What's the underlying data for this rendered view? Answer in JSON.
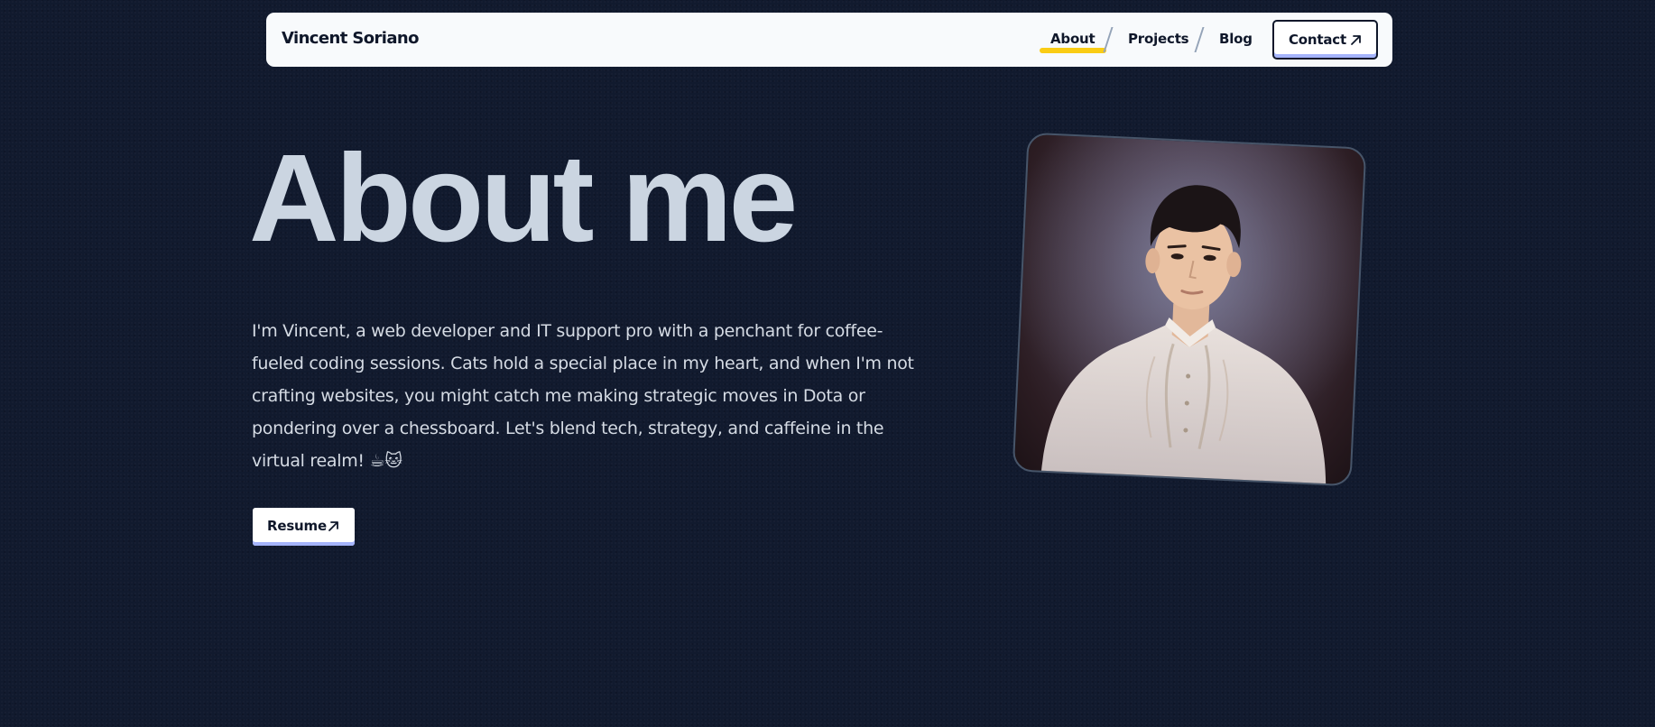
{
  "nav": {
    "brand": "Vincent Soriano",
    "links": [
      {
        "label": "About",
        "active": true
      },
      {
        "label": "Projects"
      },
      {
        "label": "Blog"
      }
    ],
    "contact_label": "Contact",
    "contact_icon": "arrow-up-right-icon"
  },
  "hero": {
    "headline": "About me",
    "bio": "I'm Vincent, a web developer and IT support pro with a penchant for coffee-fueled coding sessions. Cats hold a special place in my heart, and when I'm not crafting websites, you might catch me making strategic moves in Dota or pondering over a chessboard. Let's blend tech, strategy, and caffeine in the virtual realm! ☕🐱",
    "resume_label": "Resume",
    "resume_icon": "arrow-up-right-icon"
  },
  "portrait": {
    "description_icon": "profile-photo"
  },
  "colors": {
    "background": "#111a2e",
    "nav_background": "#f8fafc",
    "text_dark": "#0f172a",
    "headline": "#cbd5e1",
    "active_highlight": "#facc15",
    "button_underline": "#a5b4fc"
  }
}
